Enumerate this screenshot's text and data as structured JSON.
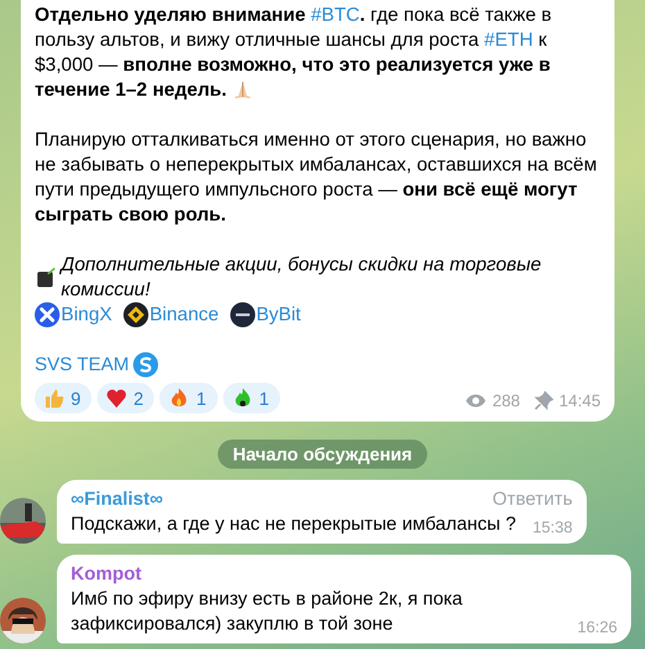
{
  "post": {
    "paragraphs": [
      [
        {
          "kind": "bold",
          "text": "Отдельно уделяю внимание "
        },
        {
          "kind": "hashtag",
          "text": "#BTC"
        },
        {
          "kind": "bold",
          "text": "."
        },
        {
          "kind": "plain",
          "text": " где пока всё также в пользу альтов, и вижу отличные шансы для роста "
        },
        {
          "kind": "hashtag",
          "text": "#ETH"
        },
        {
          "kind": "plain",
          "text": " к $3,000 — "
        },
        {
          "kind": "bold",
          "text": "вполне возможно, что это реализуется уже в течение 1–2 недель."
        },
        {
          "kind": "emoji"
        }
      ],
      [
        {
          "kind": "plain",
          "text": "Планирую отталкиваться именно от этого сценария, но важно не забывать о неперекрытых имбалансах, оставшихся на всём пути предыдущего импульсного роста — "
        },
        {
          "kind": "bold",
          "text": "они всё ещё могут сыграть свою роль."
        }
      ]
    ],
    "promo": "Дополнительные акции, бонусы скидки на торговые комиссии!",
    "exchanges": [
      {
        "kind": "bingx",
        "label": "BingX"
      },
      {
        "kind": "binance",
        "label": "Binance"
      },
      {
        "kind": "bybit",
        "label": "ByBit"
      }
    ],
    "signature": "SVS TEAM",
    "reactions": [
      {
        "kind": "thumbs",
        "count": "9"
      },
      {
        "kind": "heart",
        "count": "2"
      },
      {
        "kind": "fire",
        "count": "1"
      },
      {
        "kind": "greenfire",
        "count": "1"
      }
    ],
    "views": "288",
    "time": "14:45"
  },
  "divider": "Начало обсуждения",
  "comments": [
    {
      "author": "∞Finalist∞",
      "color": "#3a9ad9",
      "reply": "Ответить",
      "text": "Подскажи, а где у нас не перекрытые имбалансы ?",
      "time": "15:38"
    },
    {
      "author": "Kompot",
      "color": "#a35ed6",
      "text": "Имб по эфиру внизу есть в районе 2к, я пока зафиксировался) закуплю в той зоне",
      "time": "16:26"
    }
  ]
}
